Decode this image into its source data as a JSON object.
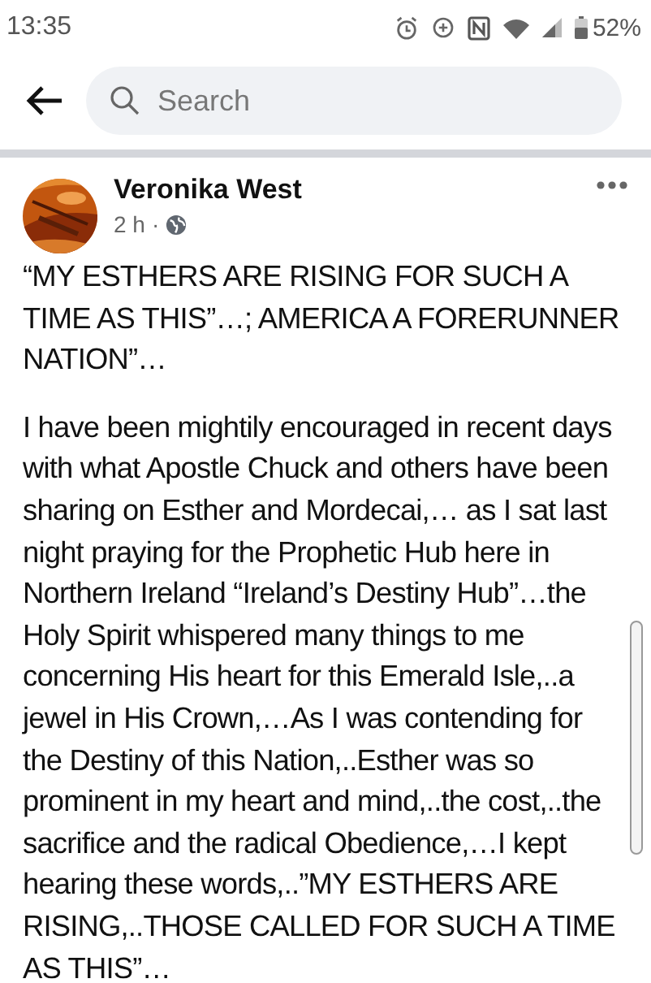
{
  "status_bar": {
    "time": "13:35",
    "battery": "52%"
  },
  "search": {
    "placeholder": "Search"
  },
  "post": {
    "author": "Veronika West",
    "time": "2 h",
    "separator": "·",
    "paragraphs": [
      "“MY ESTHERS ARE RISING FOR SUCH A TIME AS THIS”…; AMERICA A FORERUNNER NATION”…",
      "I have been mightily encouraged in recent days with what Apostle Chuck and others have been sharing on Esther and Mordecai,… as I sat last night praying for the Prophetic Hub here in Northern Ireland “Ireland’s Destiny Hub”…the Holy Spirit whispered many things to me concerning His heart for this Emerald Isle,..a jewel in His Crown,…As I was contending for the Destiny of this Nation,..Esther was so prominent in my heart and mind,..the cost,..the sacrifice and the radical Obedience,…I kept hearing these words,..”MY ESTHERS ARE RISING,..THOSE CALLED FOR SUCH A TIME AS THIS”…"
    ]
  }
}
